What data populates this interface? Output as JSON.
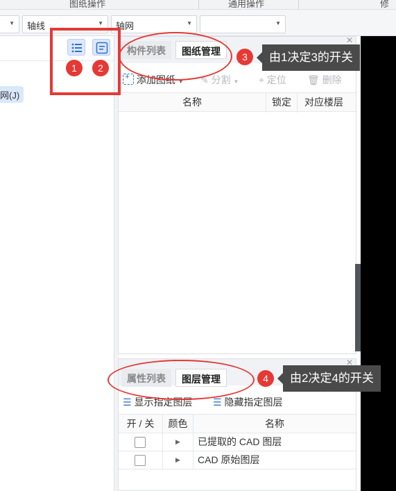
{
  "ribbon": {
    "group_drawing_ops": "图纸操作",
    "group_common_ops": "通用操作",
    "group_modify": "修改"
  },
  "toolbar": {
    "dropdown_1_value": "",
    "dropdown_2_value": "轴线",
    "dropdown_3_value": "轴网",
    "dropdown_4_value": ""
  },
  "left_pane": {
    "tree_item_label": "网(J)",
    "list_view_icon": "list-icon",
    "detail_view_icon": "detail-list-icon"
  },
  "annotations": {
    "badge_1": "1",
    "badge_2": "2",
    "badge_3": "3",
    "badge_4": "4",
    "callout_3": "由1决定3的开关",
    "callout_4": "由2决定4的开关",
    "highlight_color": "#e53935"
  },
  "top_panel": {
    "tabs": [
      {
        "label": "构件列表",
        "active": false
      },
      {
        "label": "图纸管理",
        "active": true
      }
    ],
    "tools": {
      "add_drawing": "添加图纸",
      "split": "分割",
      "locate": "定位",
      "delete": "删除"
    },
    "columns": [
      "名称",
      "锁定",
      "对应楼层"
    ],
    "rows": []
  },
  "bottom_panel": {
    "tabs": [
      {
        "label": "属性列表",
        "active": false
      },
      {
        "label": "图层管理",
        "active": true
      }
    ],
    "tools": {
      "show_layer": "显示指定图层",
      "hide_layer": "隐藏指定图层"
    },
    "columns": [
      "开 / 关",
      "颜色",
      "名称"
    ],
    "rows": [
      {
        "name": "已提取的 CAD 图层",
        "checked": false
      },
      {
        "name": "CAD 原始图层",
        "checked": false
      }
    ]
  }
}
